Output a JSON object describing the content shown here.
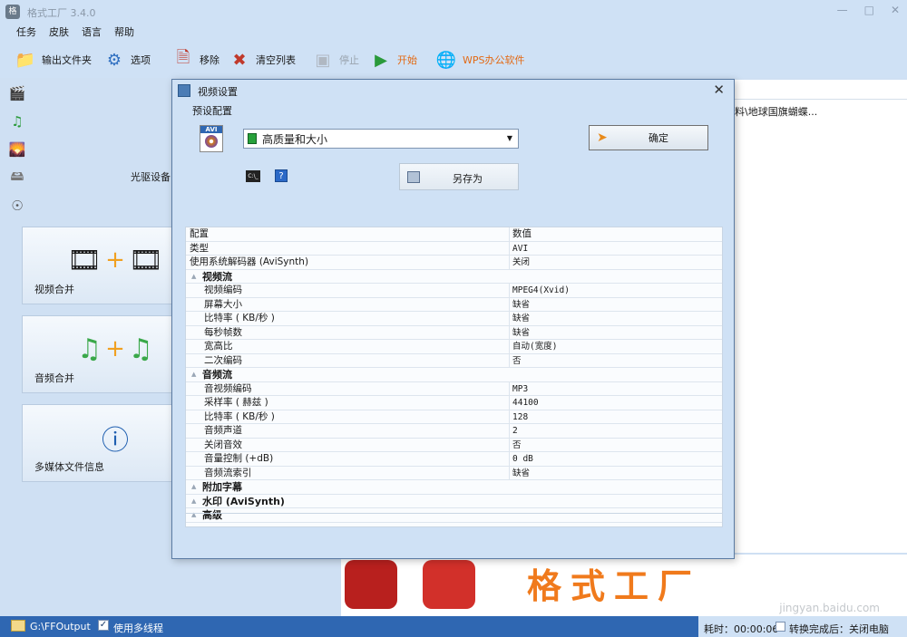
{
  "window": {
    "title": "格式工厂 3.4.0",
    "buttons": [
      "—",
      "□",
      "✕"
    ]
  },
  "menu": [
    "任务",
    "皮肤",
    "语言",
    "帮助"
  ],
  "toolbar": {
    "output_folder": "输出文件夹",
    "options": "选项",
    "remove": "移除",
    "clear_list": "清空列表",
    "stop": "停止",
    "start": "开始",
    "wps": "WPS办公软件"
  },
  "sidebar": {
    "optical_label": "光驱设备",
    "tiles": [
      "视频合并",
      "音频合并",
      "多媒体文件信息"
    ]
  },
  "file_list": {
    "text": "料\\地球国旗蝴蝶..."
  },
  "banner": {
    "brand": "格式工厂",
    "watermark": "jingyan.baidu.com"
  },
  "statusbar": {
    "path": "G:\\FFOutput",
    "multithread_label": "使用多线程",
    "elapsed": "耗时：00:00:06",
    "after_convert": "转换完成后：关闭电脑"
  },
  "dialog": {
    "title": "视频设置",
    "preset_label": "预设配置",
    "preset_value": "高质量和大小",
    "ok_label": "确定",
    "saveas_label": "另存为",
    "grid": {
      "header": {
        "key": "配置",
        "value": "数值"
      },
      "rows": [
        {
          "kind": "item",
          "key": "类型",
          "value": "AVI"
        },
        {
          "kind": "item",
          "key": "使用系统解码器 (AviSynth)",
          "value": "关闭"
        },
        {
          "kind": "cat",
          "key": "视频流",
          "value": ""
        },
        {
          "kind": "sub",
          "key": "视频编码",
          "value": "MPEG4(Xvid)"
        },
        {
          "kind": "sub",
          "key": "屏幕大小",
          "value": "缺省"
        },
        {
          "kind": "sub",
          "key": "比特率 ( KB/秒 )",
          "value": "缺省"
        },
        {
          "kind": "sub",
          "key": "每秒帧数",
          "value": "缺省"
        },
        {
          "kind": "sub",
          "key": "宽高比",
          "value": "自动(宽度)"
        },
        {
          "kind": "sub",
          "key": "二次编码",
          "value": "否"
        },
        {
          "kind": "cat",
          "key": "音频流",
          "value": ""
        },
        {
          "kind": "sub",
          "key": "音视频编码",
          "value": "MP3"
        },
        {
          "kind": "sub",
          "key": "采样率 ( 赫兹 )",
          "value": "44100"
        },
        {
          "kind": "sub",
          "key": "比特率 ( KB/秒 )",
          "value": "128"
        },
        {
          "kind": "sub",
          "key": "音频声道",
          "value": "2"
        },
        {
          "kind": "sub",
          "key": "关闭音效",
          "value": "否"
        },
        {
          "kind": "sub",
          "key": "音量控制 (+dB)",
          "value": "0 dB"
        },
        {
          "kind": "sub",
          "key": "音频流索引",
          "value": "缺省"
        },
        {
          "kind": "cat",
          "key": "附加字幕",
          "value": ""
        },
        {
          "kind": "cat",
          "key": "水印 (AviSynth)",
          "value": ""
        },
        {
          "kind": "cat",
          "key": "高级",
          "value": ""
        }
      ]
    }
  }
}
